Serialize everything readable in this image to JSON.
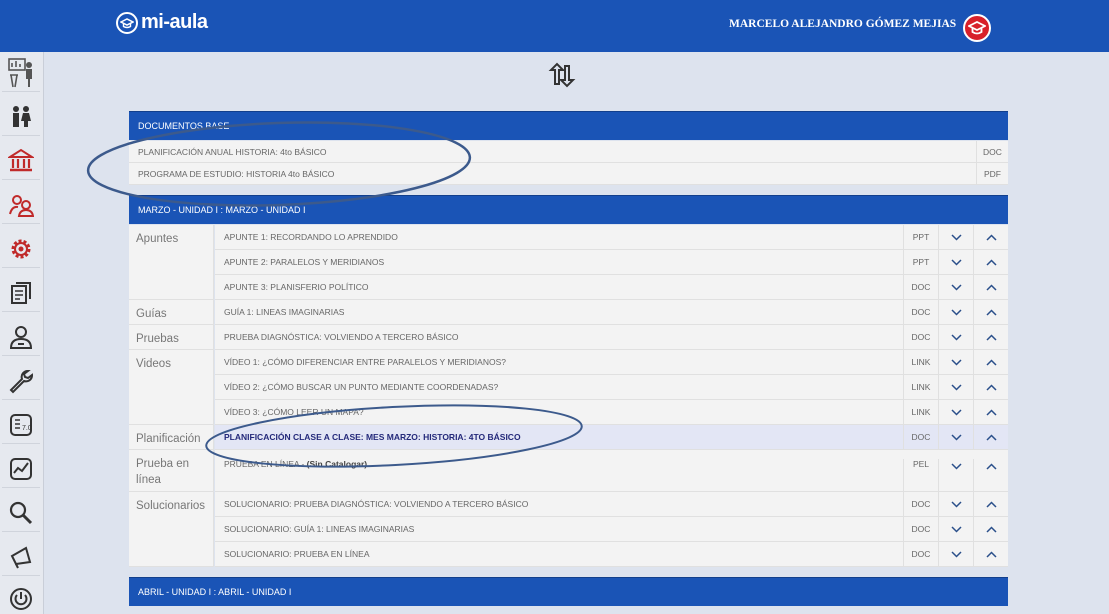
{
  "app": {
    "logo_text": "mi-aula",
    "user_name": "MARCELO ALEJANDRO GÓMEZ MEJIAS"
  },
  "sidebar": {
    "items": [
      {
        "icon": "teacher-icon"
      },
      {
        "icon": "people-icon"
      },
      {
        "icon": "institution-icon"
      },
      {
        "icon": "group-icon"
      },
      {
        "icon": "settings-icon"
      },
      {
        "icon": "documents-icon"
      },
      {
        "icon": "user-icon"
      },
      {
        "icon": "wrench-icon"
      },
      {
        "icon": "grades-icon"
      },
      {
        "icon": "chart-icon"
      },
      {
        "icon": "search-icon"
      },
      {
        "icon": "megaphone-icon"
      },
      {
        "icon": "power-icon"
      }
    ]
  },
  "documentos_base": {
    "title": "DOCUMENTOS BASE",
    "rows": [
      {
        "name": "PLANIFICACIÓN ANUAL HISTORIA: 4to BÁSICO",
        "type": "DOC"
      },
      {
        "name": "PROGRAMA DE ESTUDIO: HISTORIA 4to BÁSICO",
        "type": "PDF"
      }
    ]
  },
  "marzo": {
    "title": "MARZO - UNIDAD I : MARZO - UNIDAD I",
    "categories": {
      "apuntes": "Apuntes",
      "guias": "Guías",
      "pruebas": "Pruebas",
      "videos": "Videos",
      "planificacion": "Planificación",
      "prueba_linea": "Prueba en línea",
      "solucionarios": "Solucionarios"
    },
    "rows": [
      {
        "name": "APUNTE 1: RECORDANDO LO APRENDIDO",
        "type": "PPT"
      },
      {
        "name": "APUNTE 2: PARALELOS Y MERIDIANOS",
        "type": "PPT"
      },
      {
        "name": "APUNTE 3: PLANISFERIO POLÍTICO",
        "type": "DOC"
      },
      {
        "name": "GUÍA 1: LINEAS IMAGINARIAS",
        "type": "DOC"
      },
      {
        "name": "PRUEBA DIAGNÓSTICA: VOLVIENDO A TERCERO BÁSICO",
        "type": "DOC"
      },
      {
        "name": "VÍDEO 1: ¿CÓMO DIFERENCIAR ENTRE PARALELOS Y MERIDIANOS?",
        "type": "LINK"
      },
      {
        "name": "VÍDEO 2: ¿CÓMO BUSCAR UN PUNTO MEDIANTE COORDENADAS?",
        "type": "LINK"
      },
      {
        "name": "VÍDEO 3: ¿CÓMO LEER UN MAPA?",
        "type": "LINK"
      },
      {
        "name": "PLANIFICACIÓN CLASE A CLASE: MES MARZO: HISTORIA: 4TO BÁSICO",
        "type": "DOC"
      },
      {
        "name": "PRUEBA EN LÍNEA - ",
        "suffix": "(Sin Catalogar)",
        "type": "PEL"
      },
      {
        "name": "SOLUCIONARIO: PRUEBA DIAGNÓSTICA: VOLVIENDO A TERCERO BÁSICO",
        "type": "DOC"
      },
      {
        "name": "SOLUCIONARIO: GUÍA 1: LINEAS IMAGINARIAS",
        "type": "DOC"
      },
      {
        "name": "SOLUCIONARIO: PRUEBA EN LÍNEA",
        "type": "DOC"
      }
    ]
  },
  "abril": {
    "title": "ABRIL - UNIDAD I : ABRIL - UNIDAD I"
  },
  "colors": {
    "brand_blue": "#1a54b6",
    "highlight_row": "#e3e6f5",
    "annotation": "#3c5a8c",
    "avatar_red": "#d8202a"
  }
}
